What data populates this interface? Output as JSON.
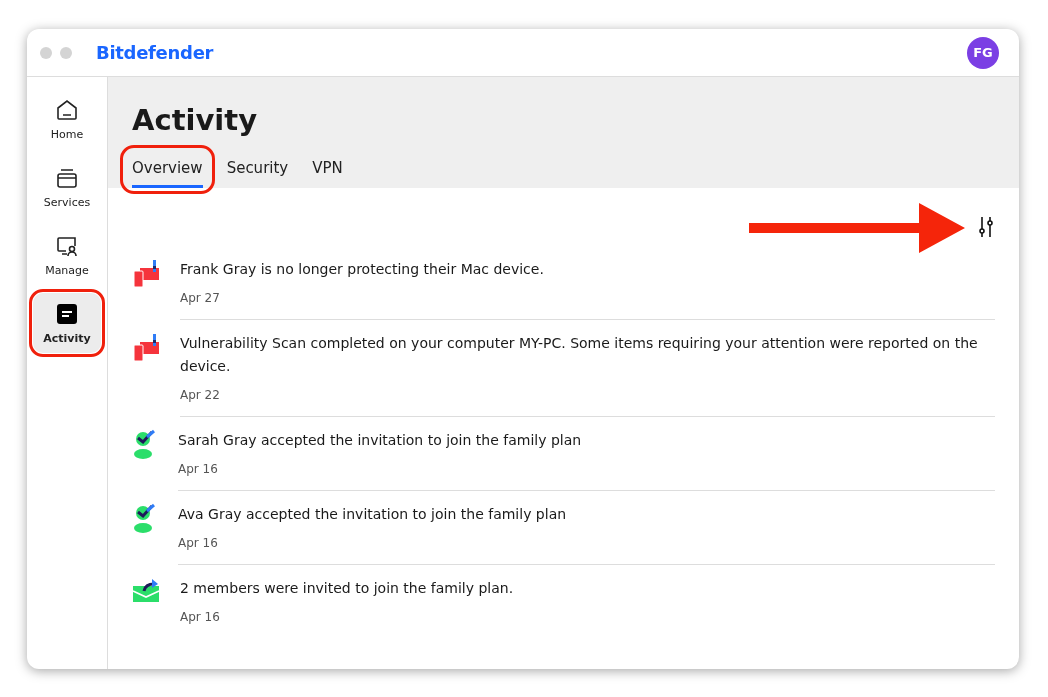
{
  "window": {
    "brand": "Bitdefender",
    "avatar": "FG"
  },
  "sidebar": {
    "items": [
      {
        "label": "Home",
        "kind": "home",
        "selected": false,
        "highlighted": false
      },
      {
        "label": "Services",
        "kind": "services",
        "selected": false,
        "highlighted": false
      },
      {
        "label": "Manage",
        "kind": "manage",
        "selected": false,
        "highlighted": false
      },
      {
        "label": "Activity",
        "kind": "activity",
        "selected": true,
        "highlighted": true
      }
    ]
  },
  "page": {
    "title": "Activity",
    "tabs": [
      {
        "label": "Overview",
        "selected": true,
        "highlighted": true
      },
      {
        "label": "Security",
        "selected": false,
        "highlighted": false
      },
      {
        "label": "VPN",
        "selected": false,
        "highlighted": false
      }
    ],
    "filter": {
      "highlighted": true
    },
    "events": [
      {
        "kind": "device-alert",
        "text": "Frank Gray is no longer protecting their Mac device.",
        "date": "Apr 27"
      },
      {
        "kind": "device-alert",
        "text": "Vulnerability Scan completed on your computer MY-PC. Some items requiring your attention were reported on the device.",
        "date": "Apr 22"
      },
      {
        "kind": "member-accepted",
        "text": "Sarah Gray accepted the invitation to join the family plan",
        "date": "Apr 16"
      },
      {
        "kind": "member-accepted",
        "text": "Ava Gray accepted the invitation to join the family plan",
        "date": "Apr 16"
      },
      {
        "kind": "invitation",
        "text": "2 members were invited to join the family plan.",
        "date": "Apr 16"
      }
    ]
  }
}
